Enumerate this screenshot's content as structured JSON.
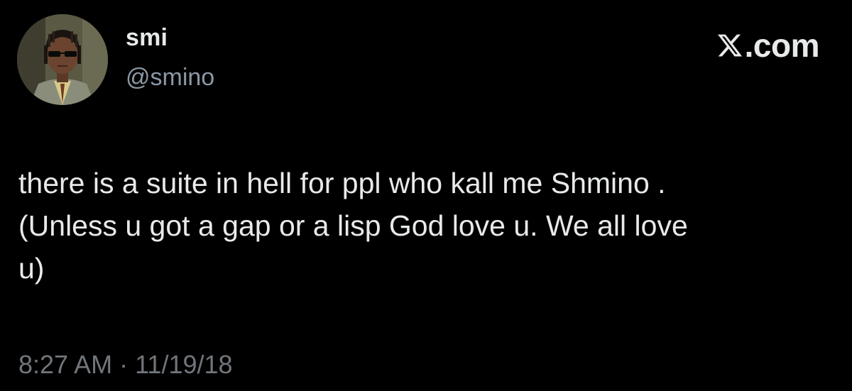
{
  "author": {
    "display_name": "smi",
    "handle": "@smino",
    "avatar_icon": "profile-avatar"
  },
  "brand": {
    "icon": "x-logo-icon",
    "label": ".com"
  },
  "tweet": {
    "text": "there is a suite in hell for ppl who kall me Shmino .\n(Unless u got a gap or a lisp God love u. We all love\nu)",
    "timestamp": "8:27 AM · 11/19/18"
  },
  "colors": {
    "background": "#000000",
    "text": "#e7e9ea",
    "handle": "#8b98a5",
    "timestamp": "#71767b"
  }
}
